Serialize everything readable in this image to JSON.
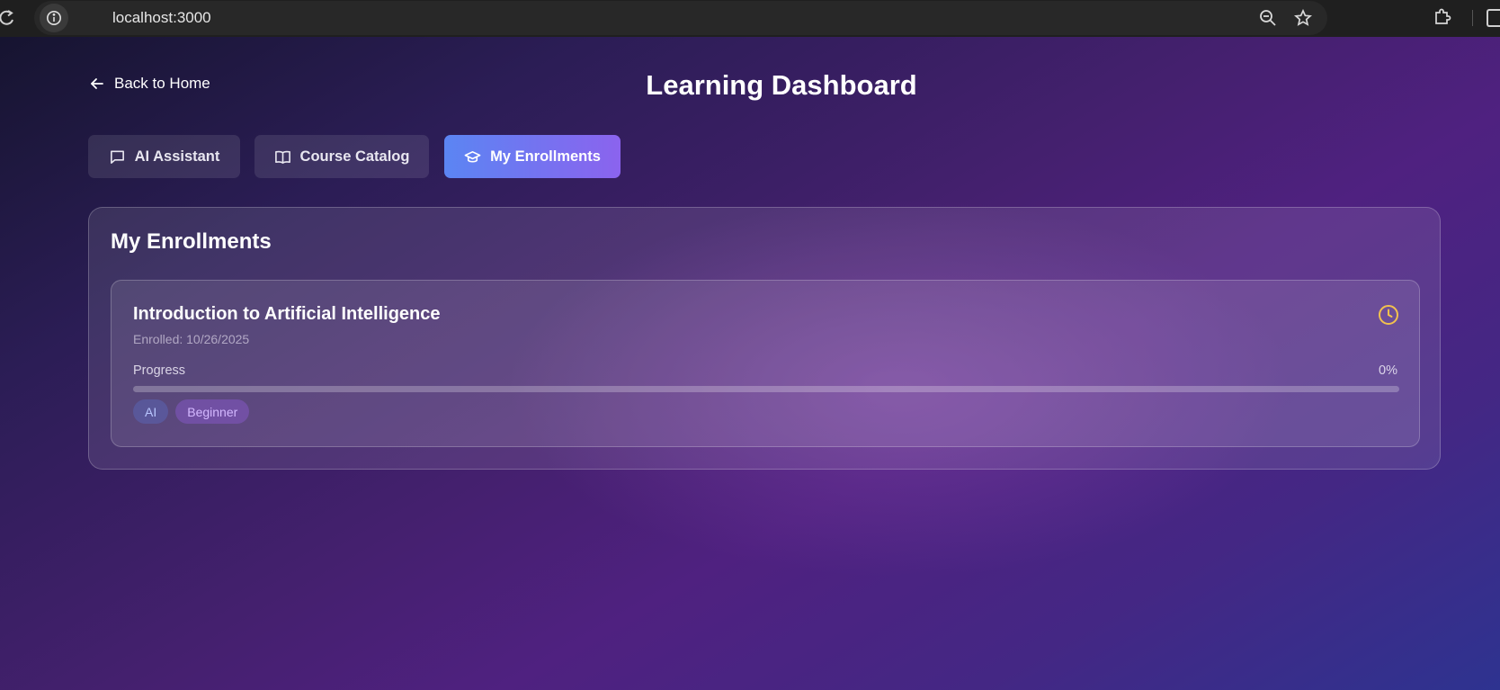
{
  "browser": {
    "url": "localhost:3000",
    "icons": [
      "reload-icon",
      "site-info-icon",
      "zoom-icon",
      "bookmark-star-icon",
      "extensions-icon",
      "side-panel-icon"
    ]
  },
  "header": {
    "back_label": "Back to Home",
    "title": "Learning Dashboard"
  },
  "tabs": [
    {
      "label": "AI Assistant",
      "icon": "chat-bubble-icon",
      "active": false
    },
    {
      "label": "Course Catalog",
      "icon": "open-book-icon",
      "active": false
    },
    {
      "label": "My Enrollments",
      "icon": "graduation-cap-icon",
      "active": true
    }
  ],
  "enrollments": {
    "title": "My Enrollments",
    "items": [
      {
        "course_title": "Introduction to Artificial Intelligence",
        "enrolled": "Enrolled: 10/26/2025",
        "progress_label": "Progress",
        "progress_text": "0%",
        "progress_value": 0,
        "status_icon": "clock-icon",
        "tags": [
          "AI",
          "Beginner"
        ]
      }
    ]
  },
  "colors": {
    "active_tab_start": "#5b85f3",
    "active_tab_end": "#8b63ee",
    "status_clock": "#f2c14e"
  }
}
